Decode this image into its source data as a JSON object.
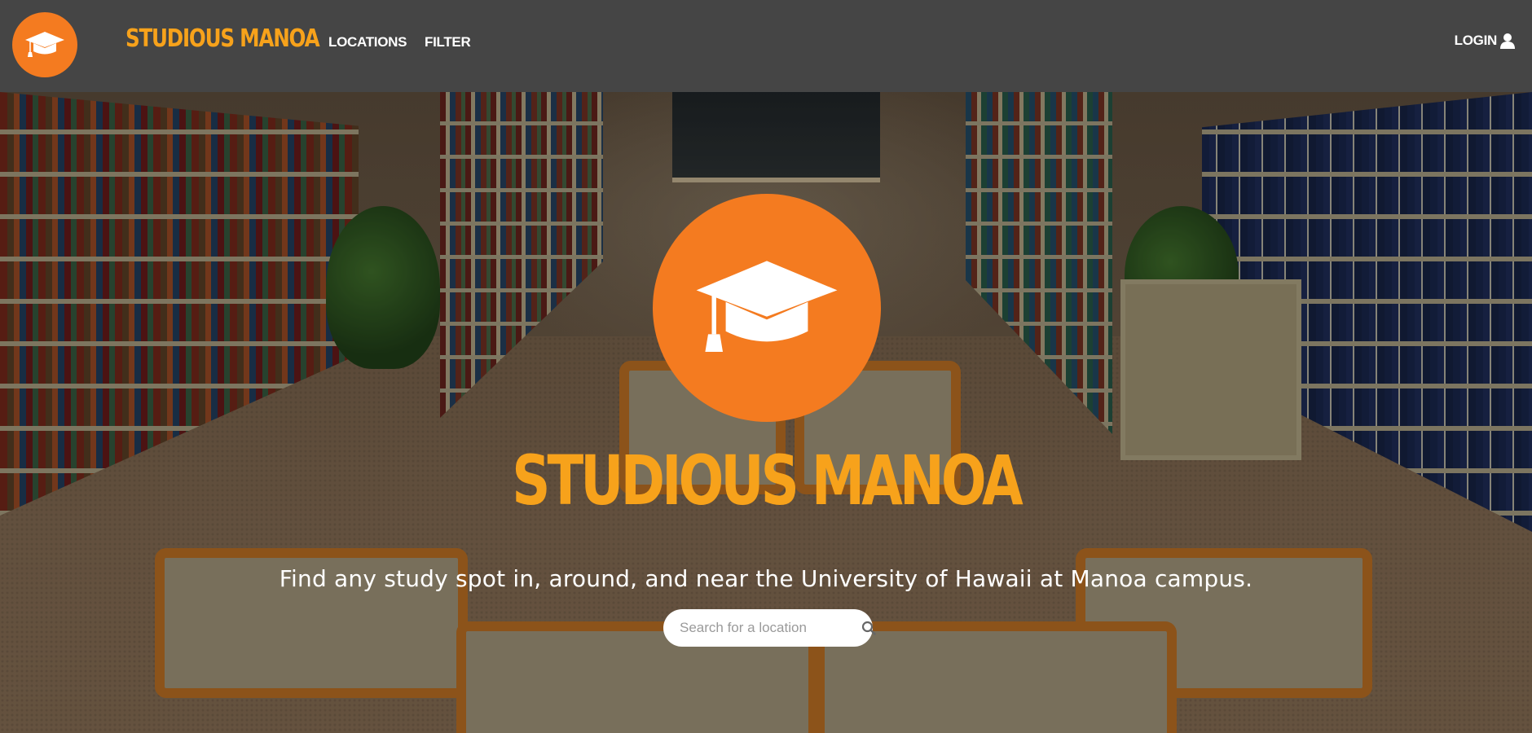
{
  "navbar": {
    "brand": "STUDIOUS MANOA",
    "links": [
      "LOCATIONS",
      "FILTER"
    ],
    "login_label": "LOGIN",
    "logo_icon": "graduation-cap-icon",
    "login_icon": "user-icon"
  },
  "hero": {
    "logo_icon": "graduation-cap-icon",
    "title": "STUDIOUS MANOA",
    "subtitle": "Find any study spot in, around, and near the University of Hawaii at Manoa campus.",
    "search": {
      "placeholder": "Search for a location",
      "value": "",
      "icon": "search-icon"
    }
  },
  "colors": {
    "accent_orange": "#f47b20",
    "brand_yellow": "#f7a21b",
    "navbar_bg": "#454545"
  }
}
